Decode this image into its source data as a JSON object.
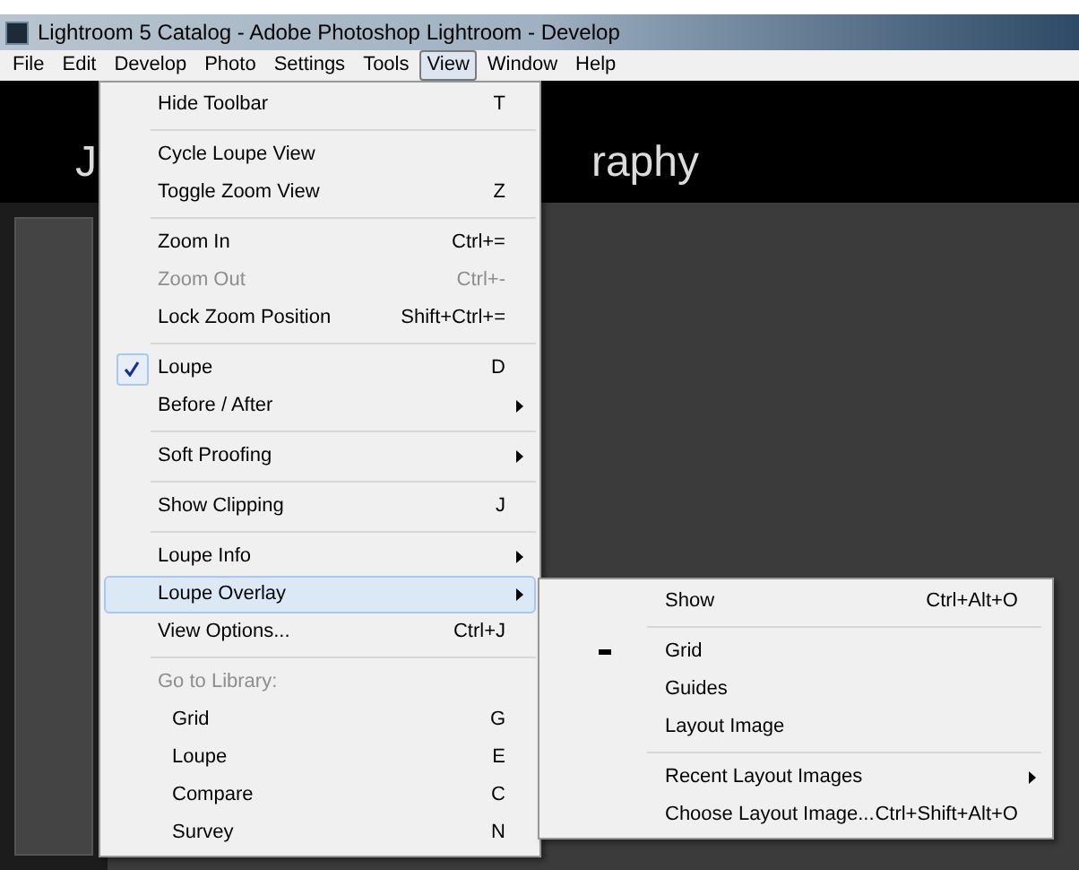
{
  "window": {
    "title": "Lightroom 5 Catalog - Adobe Photoshop Lightroom - Develop"
  },
  "menu_bar": [
    {
      "label": "File",
      "selected": false
    },
    {
      "label": "Edit",
      "selected": false
    },
    {
      "label": "Develop",
      "selected": false
    },
    {
      "label": "Photo",
      "selected": false
    },
    {
      "label": "Settings",
      "selected": false
    },
    {
      "label": "Tools",
      "selected": false
    },
    {
      "label": "View",
      "selected": true
    },
    {
      "label": "Window",
      "selected": false
    },
    {
      "label": "Help",
      "selected": false
    }
  ],
  "background": {
    "identity_plate_left": "J",
    "identity_plate_right": "raphy"
  },
  "view_menu": [
    {
      "kind": "item",
      "label": "Hide Toolbar",
      "shortcut": "T",
      "submenu": false,
      "checked": false,
      "disabled": false,
      "selected": false
    },
    {
      "kind": "separator"
    },
    {
      "kind": "item",
      "label": "Cycle Loupe View",
      "submenu": false,
      "checked": false,
      "disabled": false,
      "selected": false
    },
    {
      "kind": "item",
      "label": "Toggle Zoom View",
      "shortcut": "Z",
      "submenu": false,
      "checked": false,
      "disabled": false,
      "selected": false
    },
    {
      "kind": "separator"
    },
    {
      "kind": "item",
      "label": "Zoom In",
      "shortcut": "Ctrl+=",
      "submenu": false,
      "checked": false,
      "disabled": false,
      "selected": false
    },
    {
      "kind": "item",
      "label": "Zoom Out",
      "shortcut": "Ctrl+-",
      "submenu": false,
      "checked": false,
      "disabled": true,
      "selected": false
    },
    {
      "kind": "item",
      "label": "Lock Zoom Position",
      "shortcut": "Shift+Ctrl+=",
      "submenu": false,
      "checked": false,
      "disabled": false,
      "selected": false
    },
    {
      "kind": "separator"
    },
    {
      "kind": "item",
      "label": "Loupe",
      "shortcut": "D",
      "submenu": false,
      "checked": true,
      "disabled": false,
      "selected": false
    },
    {
      "kind": "item",
      "label": "Before / After",
      "submenu": true,
      "checked": false,
      "disabled": false,
      "selected": false
    },
    {
      "kind": "separator"
    },
    {
      "kind": "item",
      "label": "Soft Proofing",
      "submenu": true,
      "checked": false,
      "disabled": false,
      "selected": false
    },
    {
      "kind": "separator"
    },
    {
      "kind": "item",
      "label": "Show Clipping",
      "shortcut": "J",
      "submenu": false,
      "checked": false,
      "disabled": false,
      "selected": false
    },
    {
      "kind": "separator"
    },
    {
      "kind": "item",
      "label": "Loupe Info",
      "submenu": true,
      "checked": false,
      "disabled": false,
      "selected": false
    },
    {
      "kind": "item",
      "label": "Loupe Overlay",
      "submenu": true,
      "checked": false,
      "disabled": false,
      "selected": true
    },
    {
      "kind": "item",
      "label": "View Options...",
      "shortcut": "Ctrl+J",
      "submenu": false,
      "checked": false,
      "disabled": false,
      "selected": false
    },
    {
      "kind": "separator"
    },
    {
      "kind": "header",
      "label": "Go to Library:"
    },
    {
      "kind": "subitem",
      "label": "Grid",
      "shortcut": "G",
      "submenu": false,
      "checked": false,
      "disabled": false,
      "selected": false
    },
    {
      "kind": "subitem",
      "label": "Loupe",
      "shortcut": "E",
      "submenu": false,
      "checked": false,
      "disabled": false,
      "selected": false
    },
    {
      "kind": "subitem",
      "label": "Compare",
      "shortcut": "C",
      "submenu": false,
      "checked": false,
      "disabled": false,
      "selected": false
    },
    {
      "kind": "subitem",
      "label": "Survey",
      "shortcut": "N",
      "submenu": false,
      "checked": false,
      "disabled": false,
      "selected": false
    }
  ],
  "loupe_overlay_menu": [
    {
      "kind": "item",
      "label": "Show",
      "shortcut": "Ctrl+Alt+O",
      "submenu": false,
      "mixed": false
    },
    {
      "kind": "separator"
    },
    {
      "kind": "item",
      "label": "Grid",
      "submenu": false,
      "mixed": true
    },
    {
      "kind": "item",
      "label": "Guides",
      "submenu": false,
      "mixed": false
    },
    {
      "kind": "item",
      "label": "Layout Image",
      "submenu": false,
      "mixed": false
    },
    {
      "kind": "separator"
    },
    {
      "kind": "item",
      "label": "Recent Layout Images",
      "submenu": true,
      "mixed": false
    },
    {
      "kind": "item",
      "label": "Choose Layout Image...",
      "shortcut": "Ctrl+Shift+Alt+O",
      "submenu": false,
      "mixed": false
    }
  ]
}
